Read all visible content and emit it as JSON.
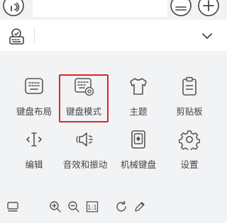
{
  "colors": {
    "panel_background": "#f2f3f5",
    "icon_stroke": "#555555",
    "label_text": "#444444",
    "highlight_border": "#e0242a"
  },
  "top_bar": {
    "icons": [
      "microphone-icon",
      "emoji-icon",
      "add-icon"
    ]
  },
  "toolbar": {
    "logo_icon": "keyboard-logo-icon",
    "right_icon": "chevron-down-icon"
  },
  "menu": {
    "row1": [
      {
        "label": "键盘布局",
        "icon": "keyboard-layout-icon"
      },
      {
        "label": "键盘模式",
        "icon": "keyboard-mode-icon",
        "highlighted": true
      },
      {
        "label": "主题",
        "icon": "tshirt-icon"
      },
      {
        "label": "剪贴板",
        "icon": "clipboard-icon"
      }
    ],
    "row2": [
      {
        "label": "编辑",
        "icon": "text-cursor-icon"
      },
      {
        "label": "音效和振动",
        "icon": "sound-vibration-icon"
      },
      {
        "label": "机械键盘",
        "icon": "mechanical-keyboard-icon"
      },
      {
        "label": "设置",
        "icon": "gear-icon"
      }
    ]
  },
  "bottom_bar": {
    "icons": [
      "keyboard-hide-icon",
      "zoom-in-icon",
      "zoom-out-icon",
      "actual-size-icon",
      "refresh-icon",
      "pencil-icon"
    ],
    "actual_size_label": "1:1"
  }
}
